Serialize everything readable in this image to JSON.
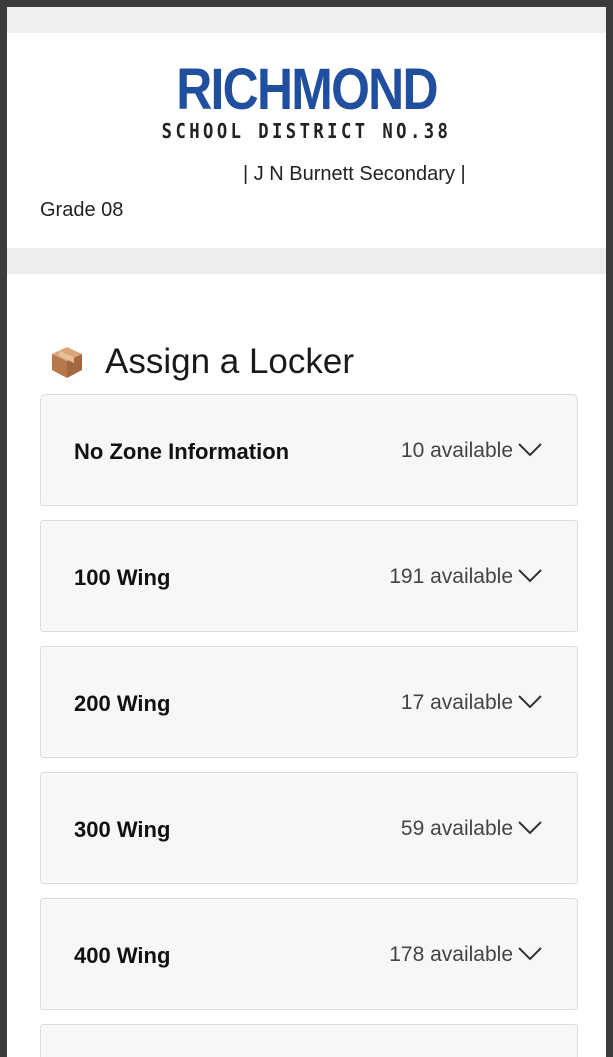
{
  "header": {
    "logo_main": "RICHMOND",
    "logo_sub": "SCHOOL DISTRICT NO.38",
    "school": "| J N Burnett Secondary |",
    "grade": "Grade 08"
  },
  "section": {
    "title": "Assign a Locker",
    "icon": "package-box-icon"
  },
  "zones": [
    {
      "name": "No Zone Information",
      "available": "10 available"
    },
    {
      "name": "100 Wing",
      "available": "191 available"
    },
    {
      "name": "200 Wing",
      "available": "17 available"
    },
    {
      "name": "300 Wing",
      "available": "59 available"
    },
    {
      "name": "400 Wing",
      "available": "178 available"
    }
  ],
  "colors": {
    "brand_blue": "#1f4f9e",
    "panel_bg": "#f7f7f9",
    "band_gray": "#ededed"
  }
}
